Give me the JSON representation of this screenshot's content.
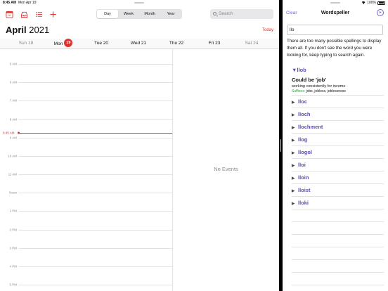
{
  "status_bar": {
    "time": "8:45 AM",
    "date": "Mon Apr 19",
    "battery": "100%"
  },
  "calendar": {
    "views": [
      "Day",
      "Week",
      "Month",
      "Year"
    ],
    "active_view": "Day",
    "search_placeholder": "Search",
    "month": "April",
    "year": "2021",
    "today_label": "Today",
    "days": [
      {
        "name": "Sun",
        "num": "18",
        "weekend": true
      },
      {
        "name": "Mon",
        "num": "19",
        "today": true
      },
      {
        "name": "Tue",
        "num": "20"
      },
      {
        "name": "Wed",
        "num": "21"
      },
      {
        "name": "Thu",
        "num": "22"
      },
      {
        "name": "Fri",
        "num": "23"
      },
      {
        "name": "Sat",
        "num": "24",
        "weekend": true
      }
    ],
    "hours": [
      "5 AM",
      "6 AM",
      "7 AM",
      "8 AM",
      "9 AM",
      "10 AM",
      "11 AM",
      "Noon",
      "1 PM",
      "2 PM",
      "3 PM",
      "4 PM",
      "5 PM"
    ],
    "now_label": "8:45 AM",
    "no_events": "No Events",
    "accent": "#e0322e"
  },
  "speller": {
    "clear_label": "Clear",
    "title": "Wordspeller",
    "go_icon": "arrow-right-circle-icon",
    "query": "llo",
    "message": "There are too many possible spellings to display them all. If you don't see the word you were looking for, keep typing to search again.",
    "expanded": {
      "word": "llob",
      "could_be": "Could be 'job'",
      "definition": "working consistently for income",
      "suffix_label": "Suffixes:",
      "suffixes": "jobs, jobless, joblessness"
    },
    "items": [
      "lloc",
      "lloch",
      "llochment",
      "llog",
      "llogol",
      "lloi",
      "lloin",
      "lloist",
      "lloki"
    ],
    "accent": "#5a4fb8"
  }
}
